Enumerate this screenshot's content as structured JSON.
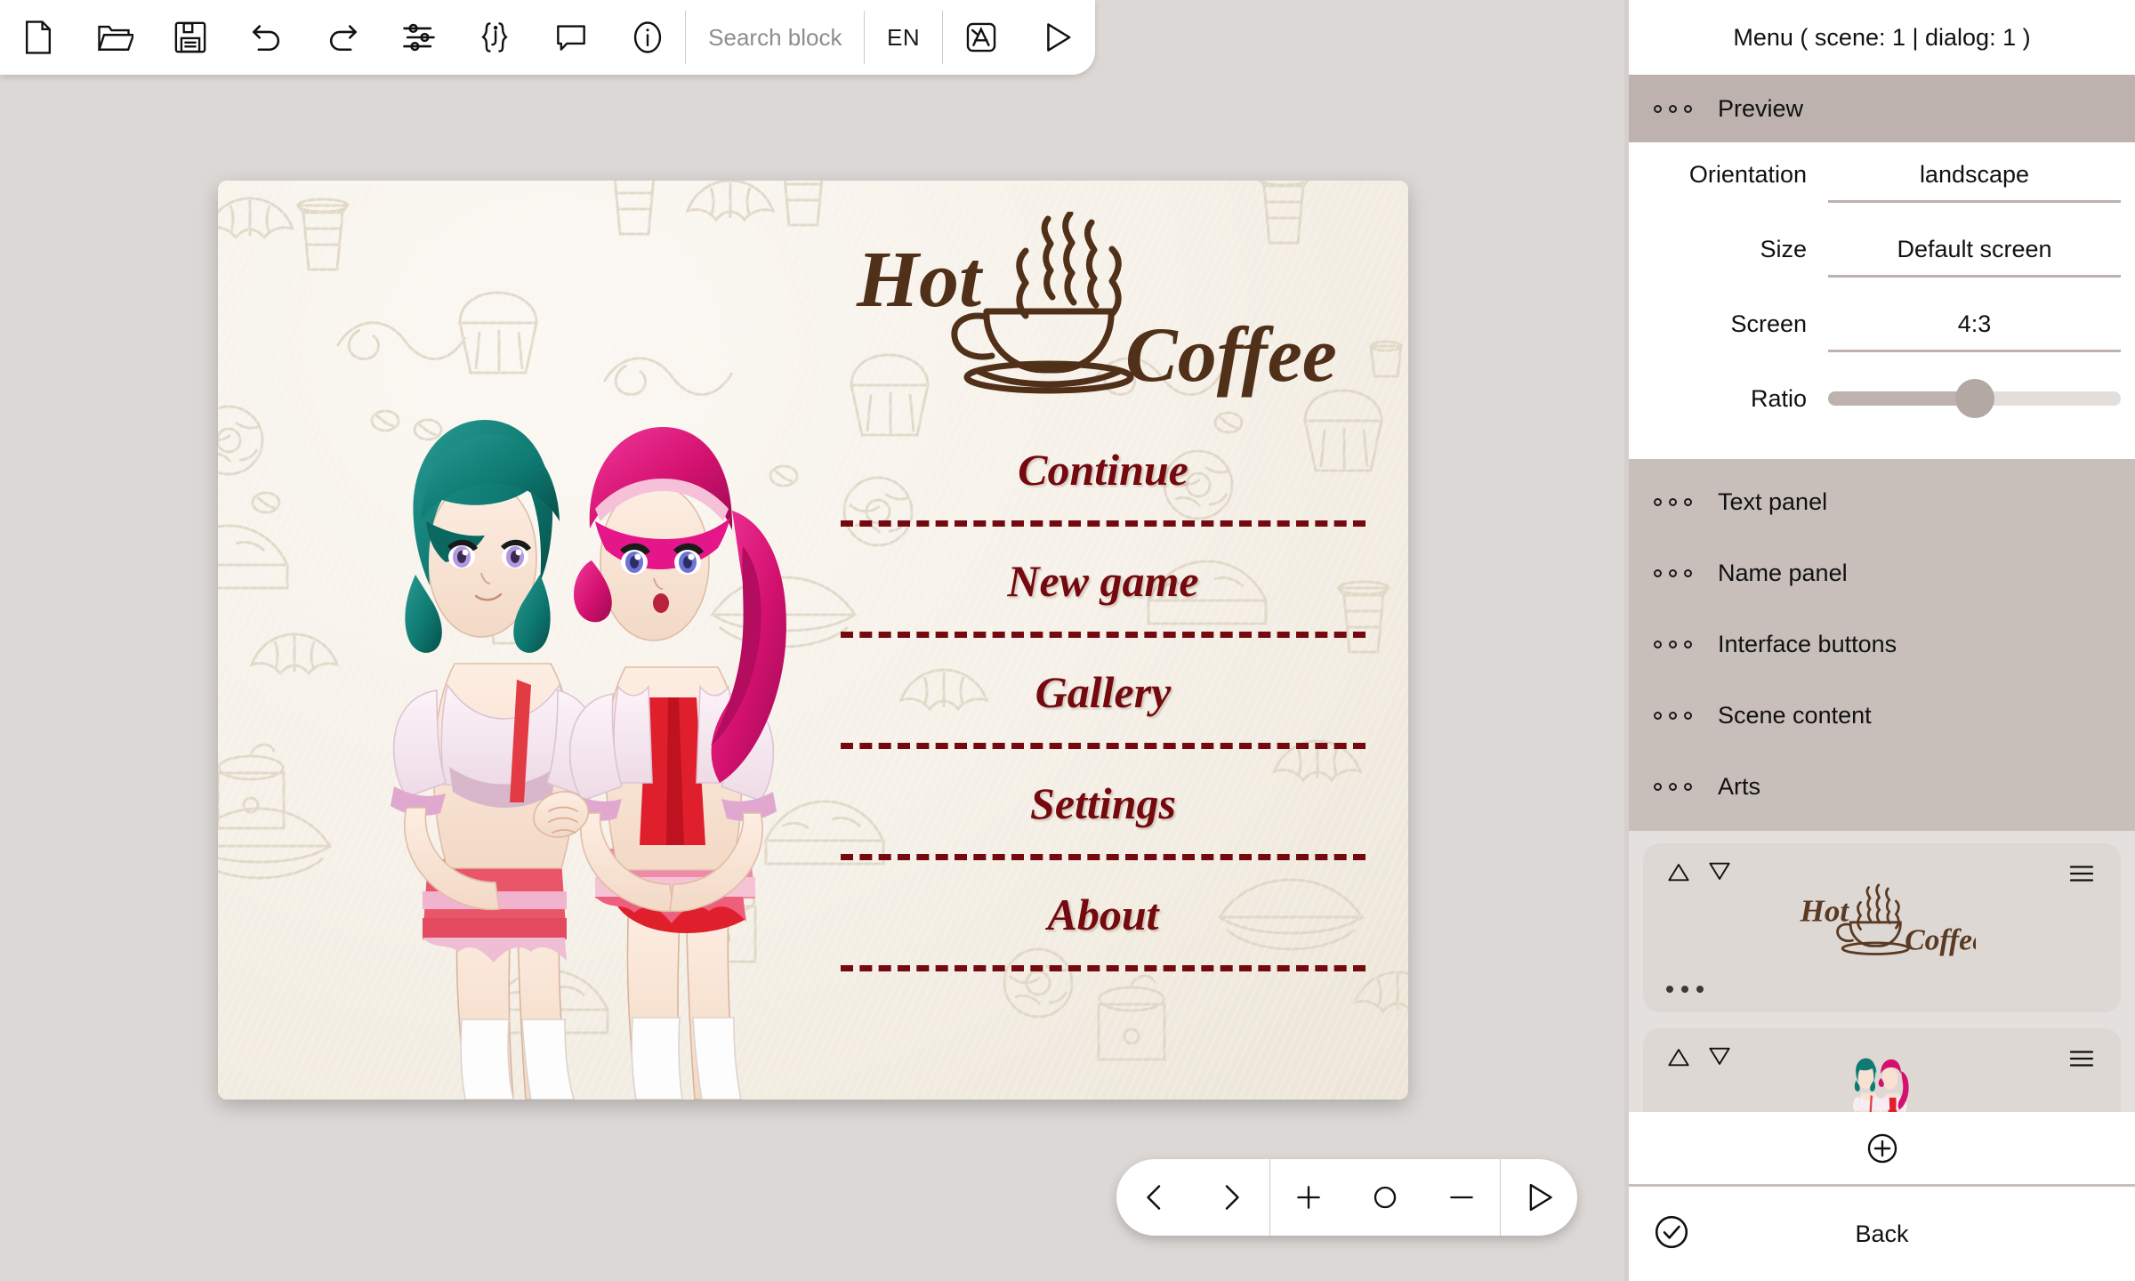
{
  "toolbar": {
    "items": [
      {
        "icon": "new-file-icon",
        "name": "new-file-button"
      },
      {
        "icon": "open-folder-icon",
        "name": "open-file-button"
      },
      {
        "icon": "save-floppy-icon",
        "name": "save-button"
      },
      {
        "icon": "undo-icon",
        "name": "undo-button"
      },
      {
        "icon": "redo-icon",
        "name": "redo-button"
      },
      {
        "icon": "sliders-icon",
        "name": "settings-button"
      },
      {
        "icon": "json-braces-icon",
        "name": "json-button"
      },
      {
        "icon": "comment-bubble-icon",
        "name": "comment-button"
      },
      {
        "icon": "info-circle-icon",
        "name": "info-button"
      }
    ],
    "search_placeholder": "Search block",
    "language": "EN",
    "translate_icon": "translate-icon",
    "play_icon": "play-icon"
  },
  "preview": {
    "logo_text_1": "Hot",
    "logo_text_2": "Coffee",
    "menu": [
      {
        "label": "Continue"
      },
      {
        "label": "New game"
      },
      {
        "label": "Gallery"
      },
      {
        "label": "Settings"
      },
      {
        "label": "About"
      }
    ],
    "menu_color": "#74090f",
    "background_color": "#f3ede2"
  },
  "bottombar": {
    "buttons": [
      {
        "icon": "chevron-left-icon",
        "name": "previous-scene-button"
      },
      {
        "icon": "chevron-right-icon",
        "name": "next-scene-button"
      },
      {
        "icon": "plus-icon",
        "name": "zoom-in-button"
      },
      {
        "icon": "circle-icon",
        "name": "zoom-reset-button"
      },
      {
        "icon": "minus-icon",
        "name": "zoom-out-button"
      },
      {
        "icon": "play-icon",
        "name": "preview-play-button"
      }
    ]
  },
  "right_panel": {
    "title": "Menu ( scene: 1 | dialog: 1 )",
    "preview_section": "Preview",
    "settings": [
      {
        "key": "Orientation",
        "value": "landscape"
      },
      {
        "key": "Size",
        "value": "Default screen"
      },
      {
        "key": "Screen",
        "value": "4:3"
      }
    ],
    "ratio": {
      "label": "Ratio",
      "percent": 50
    },
    "sections": [
      {
        "label": "Text panel"
      },
      {
        "label": "Name panel"
      },
      {
        "label": "Interface buttons"
      },
      {
        "label": "Scene content"
      },
      {
        "label": "Arts"
      }
    ],
    "layers": [
      {
        "thumb": "hot-coffee-logo-thumbnail"
      },
      {
        "thumb": "characters-sprite-thumbnail"
      }
    ],
    "add_icon": "plus-circle-icon",
    "back_label": "Back",
    "back_icon": "check-circle-icon",
    "accent_color": "#bdb2ad",
    "section_bg_color": "#c8bfbb"
  }
}
